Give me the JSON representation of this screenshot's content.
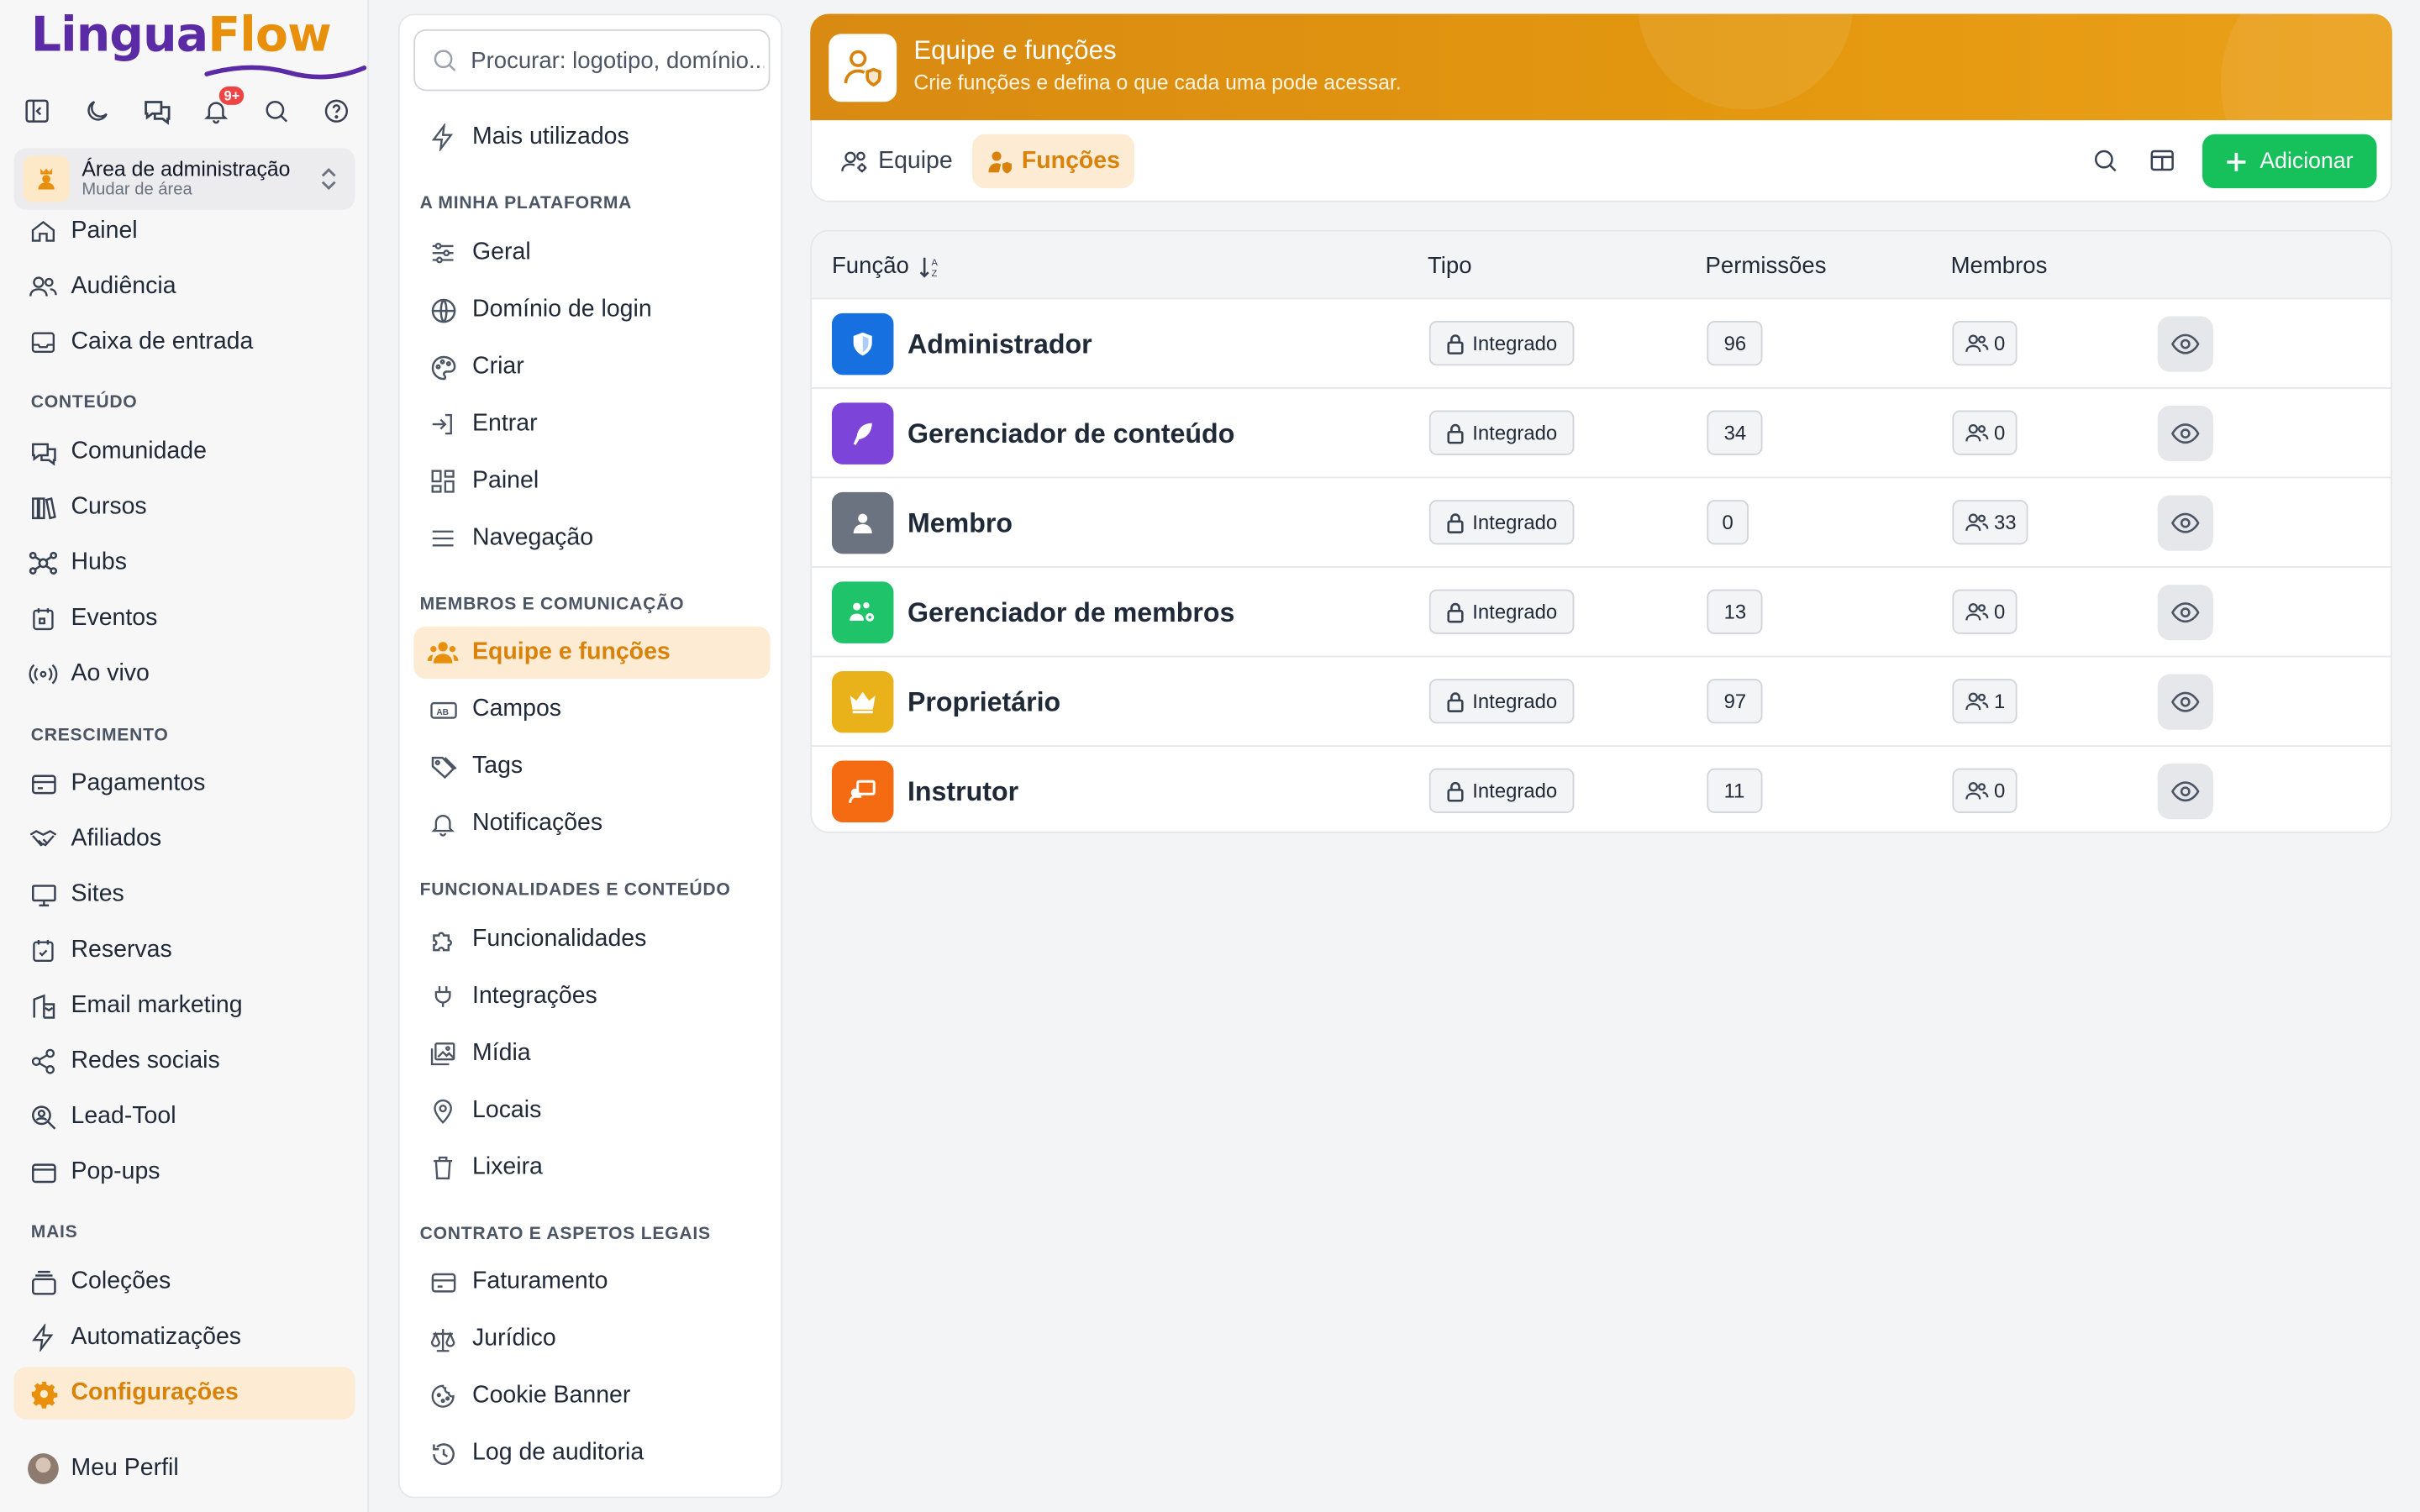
{
  "app": {
    "logo_part1": "Lingua",
    "logo_part2": "Flow",
    "notification_count": "9+"
  },
  "area": {
    "title": "Área de administração",
    "subtitle": "Mudar de área"
  },
  "nav": {
    "painel": "Painel",
    "audiencia": "Audiência",
    "caixa": "Caixa de entrada",
    "section_conteudo": "CONTEÚDO",
    "comunidade": "Comunidade",
    "cursos": "Cursos",
    "hubs": "Hubs",
    "eventos": "Eventos",
    "ao_vivo": "Ao vivo",
    "section_crescimento": "CRESCIMENTO",
    "pagamentos": "Pagamentos",
    "afiliados": "Afiliados",
    "sites": "Sites",
    "reservas": "Reservas",
    "email": "Email marketing",
    "redes": "Redes sociais",
    "lead": "Lead-Tool",
    "popups": "Pop-ups",
    "section_mais": "MAIS",
    "colecoes": "Coleções",
    "automatizacoes": "Automatizações",
    "configuracoes": "Configurações",
    "perfil": "Meu Perfil"
  },
  "settings": {
    "search_placeholder": "Procurar: logotipo, domínio...",
    "mais_utilizados": "Mais utilizados",
    "section_plataforma": "A MINHA PLATAFORMA",
    "geral": "Geral",
    "dominio": "Domínio de login",
    "criar": "Criar",
    "entrar": "Entrar",
    "painel": "Painel",
    "navegacao": "Navegação",
    "section_membros": "MEMBROS E COMUNICAÇÃO",
    "equipe_funcoes": "Equipe e funções",
    "campos": "Campos",
    "tags": "Tags",
    "notificacoes": "Notificações",
    "section_funcionalidades": "FUNCIONALIDADES E CONTEÚDO",
    "funcionalidades": "Funcionalidades",
    "integracoes": "Integrações",
    "midia": "Mídia",
    "locais": "Locais",
    "lixeira": "Lixeira",
    "section_contrato": "CONTRATO E ASPETOS LEGAIS",
    "faturamento": "Faturamento",
    "juridico": "Jurídico",
    "cookie": "Cookie Banner",
    "log": "Log de auditoria"
  },
  "header": {
    "title": "Equipe e funções",
    "subtitle": "Crie funções e defina o que cada uma pode acessar.",
    "tab_equipe": "Equipe",
    "tab_funcoes": "Funções",
    "add_label": "Adicionar"
  },
  "table": {
    "col_funcao": "Função",
    "col_tipo": "Tipo",
    "col_permissoes": "Permissões",
    "col_membros": "Membros",
    "rows": [
      {
        "name": "Administrador",
        "type": "Integrado",
        "permissions": "96",
        "members": "0",
        "color": "#1670e0",
        "icon": "shield-icon"
      },
      {
        "name": "Gerenciador de conteúdo",
        "type": "Integrado",
        "permissions": "34",
        "members": "0",
        "color": "#7c44d9",
        "icon": "feather-icon"
      },
      {
        "name": "Membro",
        "type": "Integrado",
        "permissions": "0",
        "members": "33",
        "color": "#6b7280",
        "icon": "user-icon"
      },
      {
        "name": "Gerenciador de membros",
        "type": "Integrado",
        "permissions": "13",
        "members": "0",
        "color": "#1fc46a",
        "icon": "users-gear-icon"
      },
      {
        "name": "Proprietário",
        "type": "Integrado",
        "permissions": "97",
        "members": "1",
        "color": "#eab21a",
        "icon": "crown-icon"
      },
      {
        "name": "Instrutor",
        "type": "Integrado",
        "permissions": "11",
        "members": "0",
        "color": "#f56b12",
        "icon": "presenter-icon"
      }
    ]
  }
}
